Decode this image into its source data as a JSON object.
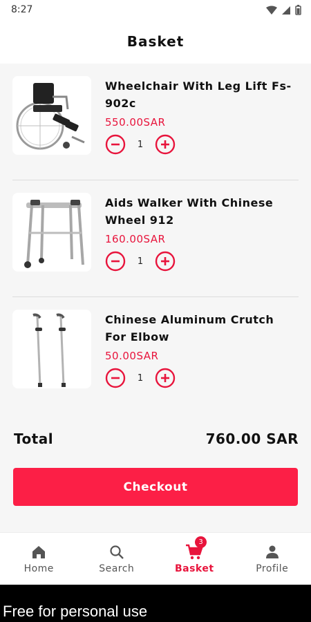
{
  "status": {
    "time": "8:27"
  },
  "header": {
    "title": "Basket"
  },
  "items": [
    {
      "name": "Wheelchair With Leg Lift Fs-902c",
      "price": "550.00SAR",
      "qty": "1",
      "image": "wheelchair"
    },
    {
      "name": "Aids Walker With Chinese Wheel 912",
      "price": "160.00SAR",
      "qty": "1",
      "image": "walker"
    },
    {
      "name": "Chinese Aluminum Crutch For Elbow",
      "price": "50.00SAR",
      "qty": "1",
      "image": "crutch"
    }
  ],
  "summary": {
    "total_label": "Total",
    "total_value": "760.00 SAR"
  },
  "checkout_label": "Checkout",
  "nav": {
    "home": "Home",
    "search": "Search",
    "basket": "Basket",
    "profile": "Profile",
    "basket_badge": "3"
  },
  "footer_text": "Free for personal use",
  "colors": {
    "accent": "#fc1f46",
    "price": "#e8143c"
  },
  "icons": [
    "wifi-icon",
    "signal-icon",
    "battery-icon",
    "minus-icon",
    "plus-icon",
    "home-icon",
    "search-icon",
    "cart-icon",
    "person-icon"
  ]
}
